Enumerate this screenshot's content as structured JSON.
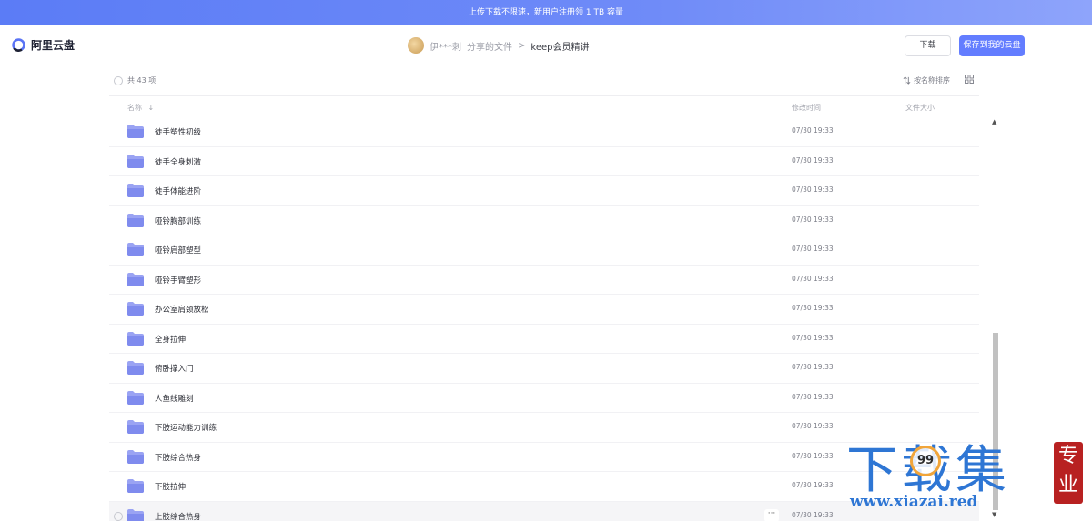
{
  "banner": {
    "text": "上传下载不限速，新用户注册领 1 TB 容量"
  },
  "header": {
    "logo_text": "阿里云盘",
    "sharer": "伊***刺",
    "shared_label": "分享的文件",
    "separator": ">",
    "current_folder": "keep会员精讲",
    "download_label": "下载",
    "save_label": "保存到我的云盘"
  },
  "toolbar": {
    "total": "共 43 项",
    "sort_label": "按名称排序"
  },
  "columns": {
    "name": "名称",
    "modified": "修改时间",
    "size": "文件大小"
  },
  "files": [
    {
      "name": "徒手塑性初级",
      "date": "07/30 19:33"
    },
    {
      "name": "徒手全身刺激",
      "date": "07/30 19:33"
    },
    {
      "name": "徒手体能进阶",
      "date": "07/30 19:33"
    },
    {
      "name": "哑铃胸部训练",
      "date": "07/30 19:33"
    },
    {
      "name": "哑铃肩部塑型",
      "date": "07/30 19:33"
    },
    {
      "name": "哑铃手臂塑形",
      "date": "07/30 19:33"
    },
    {
      "name": "办公室肩颈放松",
      "date": "07/30 19:33"
    },
    {
      "name": "全身拉伸",
      "date": "07/30 19:33"
    },
    {
      "name": "俯卧撑入门",
      "date": "07/30 19:33"
    },
    {
      "name": "人鱼线雕刻",
      "date": "07/30 19:33"
    },
    {
      "name": "下肢运动能力训练",
      "date": "07/30 19:33"
    },
    {
      "name": "下肢综合热身",
      "date": "07/30 19:33"
    },
    {
      "name": "下肢拉伸",
      "date": "07/30 19:33"
    },
    {
      "name": "上肢综合热身",
      "date": "07/30 19:33"
    }
  ],
  "more_label": "···",
  "watermark": {
    "big": "下载集",
    "url": "www.xiazai.red",
    "seal": "专业",
    "badge": "99"
  },
  "colors": {
    "accent": "#637dff",
    "folder": "#8b95f0"
  }
}
